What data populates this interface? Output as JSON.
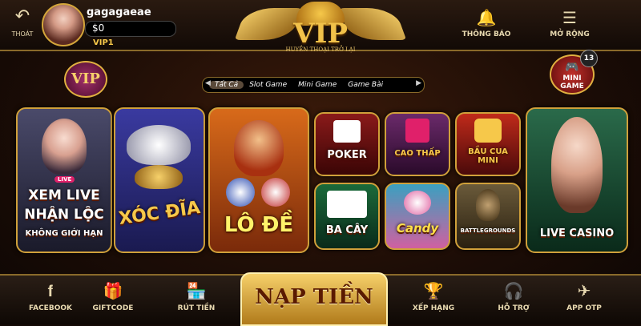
{
  "header": {
    "back_label": "THOÁT",
    "username": "gagagaeae",
    "balance": "$0",
    "vip_level": "VIP1",
    "logo_text": "VIP",
    "logo_tagline": "HUYỀN THOẠI TRỞ LẠI",
    "notify_label": "THÔNG BÁO",
    "expand_label": "MỞ RỘNG"
  },
  "badges": {
    "vip_badge": "VIP",
    "mini_game_line1": "MINI",
    "mini_game_line2": "GAME",
    "mini_game_count": "13"
  },
  "tabs": [
    "Tất Cả",
    "Slot Game",
    "Mini Game",
    "Game Bài"
  ],
  "games": {
    "live_lines": [
      "XEM LIVE",
      "NHẬN LỘC",
      "KHÔNG GIỚI HẠN"
    ],
    "live_badge": "LIVE",
    "xoc_dia": "XÓC ĐĨA",
    "lo_de": "LÔ ĐỀ",
    "poker": "POKER",
    "cao_thap": "CAO THẤP",
    "bau_cua": "BẦU CUA MINI",
    "ba_cay": "BA CÂY",
    "candy": "Candy",
    "pubg": "BATTLEGROUNDS",
    "live_casino": "LIVE CASINO"
  },
  "footer": {
    "facebook": "FACEBOOK",
    "giftcode": "GIFTCODE",
    "rut_tien": "RÚT TIỀN",
    "nap_tien": "NẠP TIỀN",
    "xep_hang": "XẾP HẠNG",
    "ho_tro": "HỖ TRỢ",
    "app_otp": "APP OTP"
  },
  "colors": {
    "gold": "#d0a03a",
    "accent": "#f6c84a"
  },
  "icons": [
    "back-arrow-icon",
    "bell-icon",
    "menu-icon",
    "facebook-icon",
    "gift-icon",
    "store-icon",
    "trophy-icon",
    "headset-icon",
    "paper-plane-icon"
  ]
}
